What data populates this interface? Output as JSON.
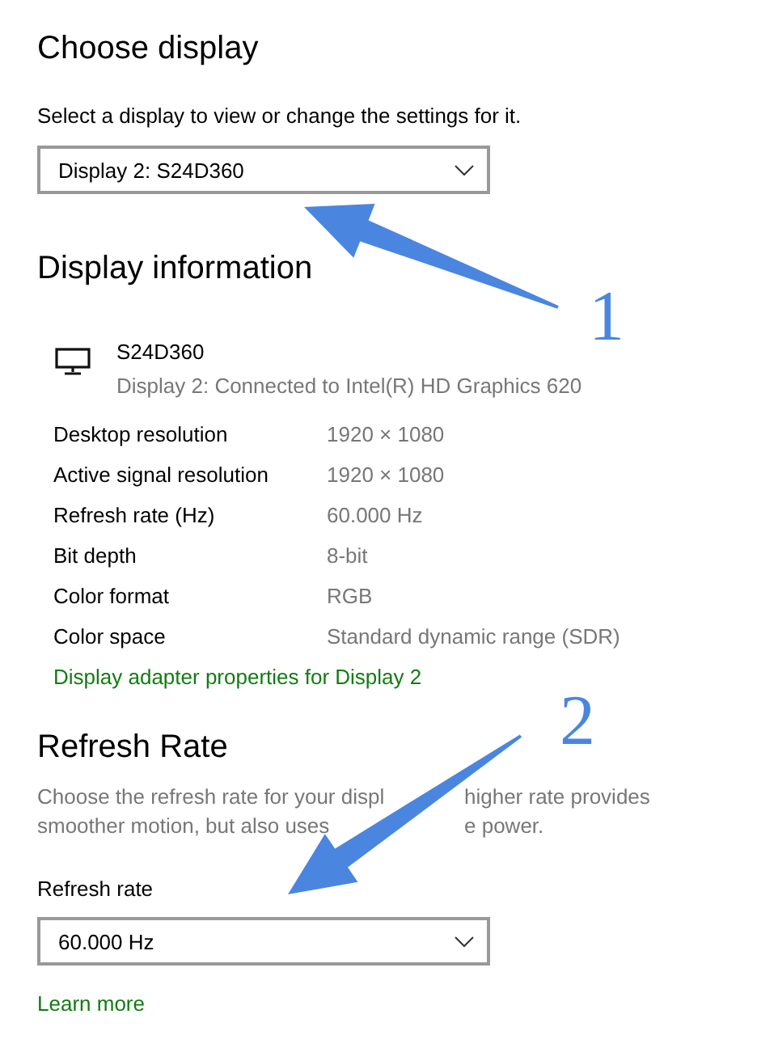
{
  "choose_display": {
    "title": "Choose display",
    "label": "Select a display to view or change the settings for it.",
    "dropdown": {
      "value": "Display 2: S24D360"
    }
  },
  "display_information": {
    "title": "Display information",
    "monitor": {
      "name": "S24D360",
      "subtitle": "Display 2: Connected to Intel(R) HD Graphics 620"
    },
    "rows": [
      {
        "label": "Desktop resolution",
        "value": "1920 × 1080"
      },
      {
        "label": "Active signal resolution",
        "value": "1920 × 1080"
      },
      {
        "label": "Refresh rate (Hz)",
        "value": "60.000 Hz"
      },
      {
        "label": "Bit depth",
        "value": "8-bit"
      },
      {
        "label": "Color format",
        "value": "RGB"
      },
      {
        "label": "Color space",
        "value": "Standard dynamic range (SDR)"
      }
    ],
    "link": "Display adapter properties for Display 2"
  },
  "refresh_rate": {
    "title": "Refresh Rate",
    "description_lines": [
      [
        "Choose the refresh rate for your displ",
        "higher rate provides"
      ],
      [
        "smoother motion, but also uses",
        "e power."
      ]
    ],
    "label": "Refresh rate",
    "dropdown": {
      "value": "60.000 Hz"
    },
    "link": "Learn more"
  },
  "annotations": [
    {
      "label": "1"
    },
    {
      "label": "2"
    }
  ]
}
